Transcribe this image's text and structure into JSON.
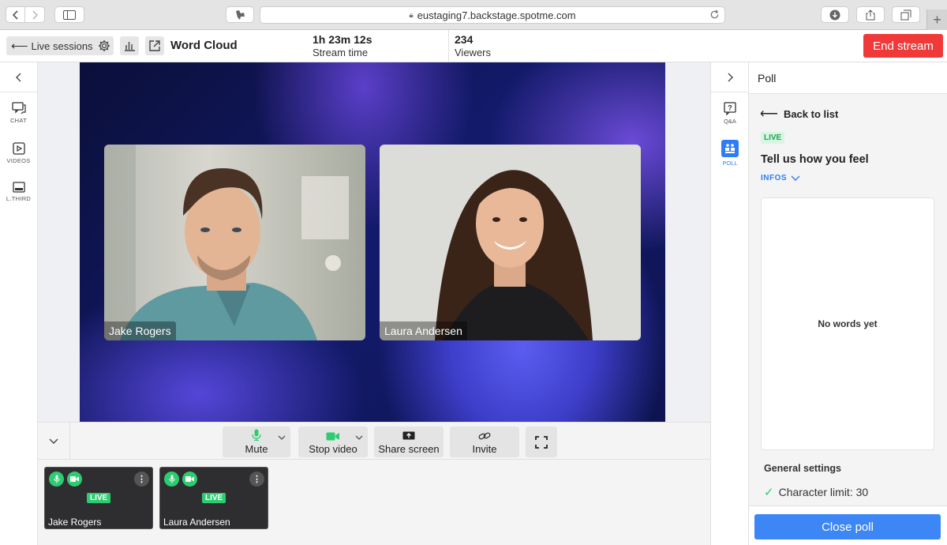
{
  "browser": {
    "url": "eustaging7.backstage.spotme.com",
    "new_tab": "+"
  },
  "header": {
    "back_label": "Live sessions",
    "session_title": "Word Cloud",
    "stream_time_value": "1h 23m 12s",
    "stream_time_label": "Stream time",
    "viewers_value": "234",
    "viewers_label": "Viewers",
    "end_stream_label": "End stream"
  },
  "left_sidebar": {
    "items": [
      {
        "label": "CHAT",
        "icon": "chat-icon"
      },
      {
        "label": "VIDEOS",
        "icon": "video-icon"
      },
      {
        "label": "L.THIRD",
        "icon": "lower-third-icon"
      }
    ]
  },
  "stage": {
    "speakers": [
      {
        "name": "Jake Rogers"
      },
      {
        "name": "Laura Andersen"
      }
    ]
  },
  "controls": {
    "mute_label": "Mute",
    "stop_video_label": "Stop video",
    "share_screen_label": "Share screen",
    "invite_label": "Invite"
  },
  "participants": [
    {
      "name": "Jake Rogers",
      "status": "LIVE"
    },
    {
      "name": "Laura Andersen",
      "status": "LIVE"
    }
  ],
  "right_rail": {
    "items": [
      {
        "label": "Q&A",
        "icon": "qa-icon"
      },
      {
        "label": "POLL",
        "icon": "poll-icon"
      }
    ]
  },
  "poll": {
    "header": "Poll",
    "back_label": "Back to list",
    "status": "LIVE",
    "question": "Tell us how you feel",
    "infos_label": "INFOS",
    "empty_text": "No words yet",
    "settings_title": "General settings",
    "char_limit": "Character limit: 30",
    "close_label": "Close poll"
  },
  "colors": {
    "end_stream": "#f03a3a",
    "close_poll": "#3d86f5",
    "live_green": "#2ecc71",
    "accent_blue": "#2f7df6"
  }
}
